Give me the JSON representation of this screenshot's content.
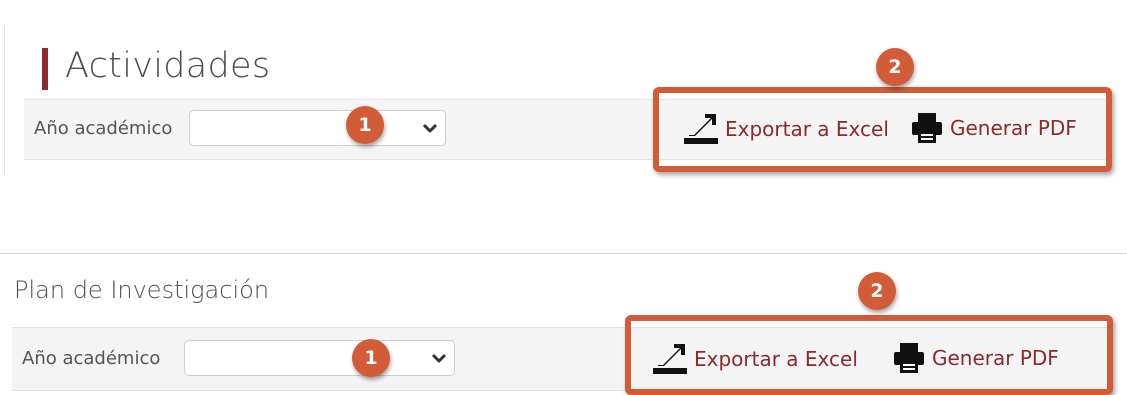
{
  "sections": [
    {
      "title": "Actividades",
      "field_label": "Año académico",
      "select_value": "",
      "callout_select": "1",
      "callout_actions": "2",
      "export_excel": "Exportar a Excel",
      "generate_pdf": "Generar PDF"
    },
    {
      "title": "Plan de Investigación",
      "field_label": "Año académico",
      "select_value": "",
      "callout_select": "1",
      "callout_actions": "2",
      "export_excel": "Exportar a Excel",
      "generate_pdf": "Generar PDF"
    }
  ],
  "colors": {
    "accent": "#8b2a2c",
    "callout": "#d25c37",
    "toolbar_bg": "#f4f4f4"
  },
  "icons": {
    "excel": "export-excel-icon",
    "pdf": "printer-icon",
    "select": "chevron-down-icon"
  }
}
